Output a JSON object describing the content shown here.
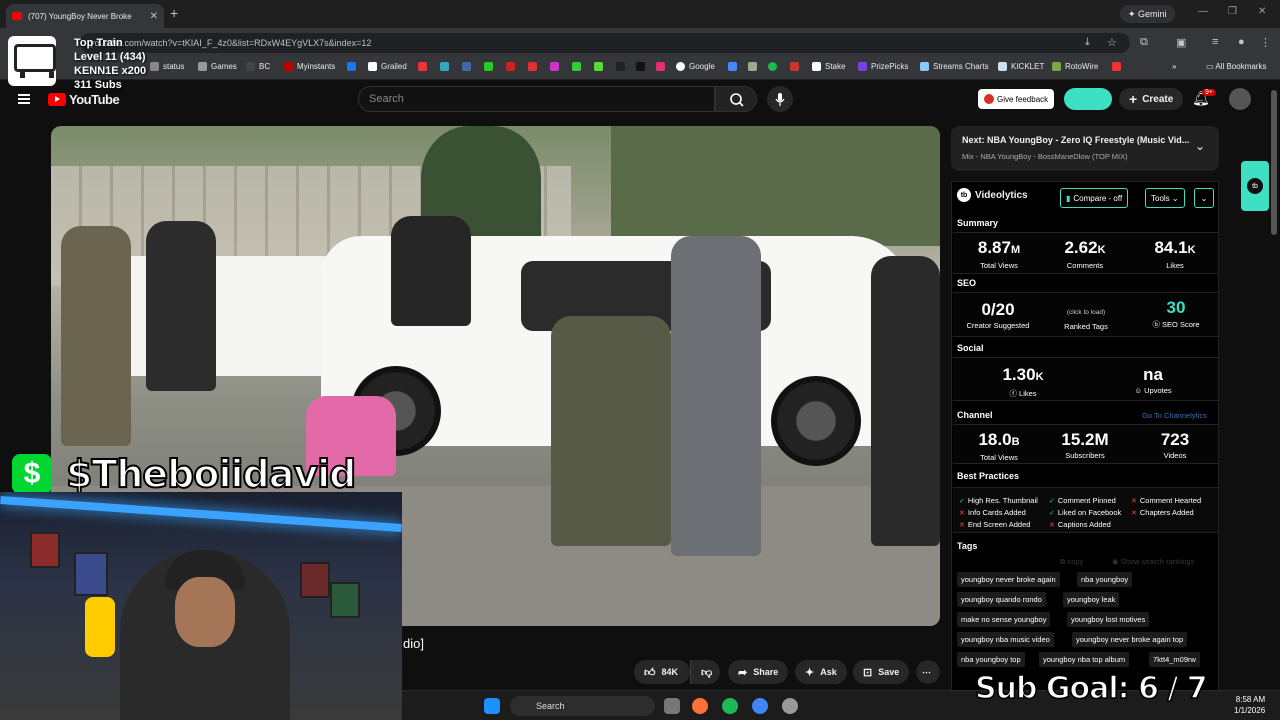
{
  "browser": {
    "tab_title": "(707) YoungBoy Never Broke",
    "url": "youtube.com/watch?v=tKIAI_F_4z0&list=RDxW4EYgVLX7s&index=12",
    "gemini_label": "Gemini",
    "bookmarks": [
      "status",
      "Games",
      "BC",
      "Myinstants",
      "Grailed",
      "Google",
      "Stake",
      "PrizePicks",
      "Streams Charts",
      "KICKLET",
      "RotoWire"
    ],
    "all_bookmarks": "All Bookmarks"
  },
  "overlay": {
    "train_title": "Top Train",
    "train_level": "Level 11  (434)",
    "train_user": "KENN1E x200",
    "train_subs": "311 Subs",
    "cashtag": "$Theboiidavid",
    "sub_goal": "Sub Goal:  6 / 7",
    "caption_fragment": "dio]"
  },
  "youtube": {
    "logo_text": "YouTube",
    "search_placeholder": "Search",
    "give_feedback": "Give feedback",
    "create_label": "Create",
    "notif_badge": "9+",
    "actions": {
      "likes": "84K",
      "share": "Share",
      "ask": "Ask",
      "save": "Save"
    },
    "up_next": {
      "title": "Next: NBA YoungBoy - Zero IQ Freestyle (Music Vid...",
      "subtitle": "Mix - NBA YoungBoy - BossManeDlow (TOP MIX)"
    }
  },
  "videolytics": {
    "title": "Videolytics",
    "compare_label": "Compare - off",
    "tools_label": "Tools",
    "summary_label": "Summary",
    "summary": [
      {
        "value": "8.87",
        "unit": "M",
        "label": "Total Views"
      },
      {
        "value": "2.62",
        "unit": "K",
        "label": "Comments"
      },
      {
        "value": "84.1",
        "unit": "K",
        "label": "Likes"
      }
    ],
    "seo_label": "SEO",
    "seo": {
      "creator_value": "0/20",
      "creator_label": "Creator Suggested",
      "ranked_hint": "(click to load)",
      "ranked_label": "Ranked Tags",
      "score_value": "30",
      "score_label": "SEO Score"
    },
    "social_label": "Social",
    "social": {
      "likes_value": "1.30",
      "likes_unit": "K",
      "likes_label": "Likes",
      "upvotes_value": "na",
      "upvotes_label": "Upvotes"
    },
    "channel_label": "Channel",
    "channel_link": "Go To Channelytics",
    "channel": [
      {
        "value": "18.0",
        "unit": "B",
        "label": "Total Views"
      },
      {
        "value": "15.2M",
        "unit": "",
        "label": "Subscribers"
      },
      {
        "value": "723",
        "unit": "",
        "label": "Videos"
      }
    ],
    "best_practices_label": "Best Practices",
    "best_practices": [
      {
        "text": "High Res. Thumbnail",
        "ok": true
      },
      {
        "text": "Comment Pinned",
        "ok": true
      },
      {
        "text": "Comment Hearted",
        "ok": false
      },
      {
        "text": "Info Cards Added",
        "ok": false
      },
      {
        "text": "Liked on Facebook",
        "ok": true
      },
      {
        "text": "Chapters Added",
        "ok": false
      },
      {
        "text": "End Screen Added",
        "ok": false
      },
      {
        "text": "Captions Added",
        "ok": false
      }
    ],
    "tags_label": "Tags",
    "copy_label": "copy",
    "show_rankings": "Show search rankings",
    "tags": [
      "youngboy never broke again",
      "nba youngboy",
      "youngboy quando rondo",
      "youngboy leak",
      "make no sense youngboy",
      "youngboy lost motives",
      "youngboy nba music video",
      "youngboy never broke again top",
      "nba youngboy top",
      "youngboy nba top album",
      "7ktt4_m09rw"
    ]
  },
  "taskbar": {
    "search": "Search",
    "time": "8:58 AM",
    "date": "1/1/2026"
  },
  "colors": {
    "accent": "#3ee0c3",
    "youtube_red": "#ff0000",
    "cashapp_green": "#00d632"
  }
}
